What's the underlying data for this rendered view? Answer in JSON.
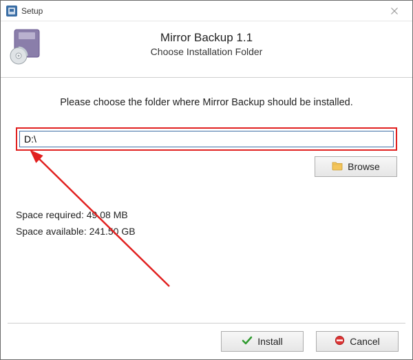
{
  "window": {
    "title": "Setup"
  },
  "header": {
    "product_title": "Mirror Backup 1.1",
    "subtitle": "Choose Installation Folder"
  },
  "body": {
    "instruction": "Please choose the folder where Mirror Backup should be installed.",
    "path_value": "D:\\",
    "browse_label": "Browse",
    "space_required_label": "Space required:",
    "space_required_value": "49.08 MB",
    "space_available_label": "Space available:",
    "space_available_value": "241.50 GB"
  },
  "buttons": {
    "install": "Install",
    "cancel": "Cancel"
  },
  "annotation": {
    "highlight_color": "#e1201f"
  }
}
